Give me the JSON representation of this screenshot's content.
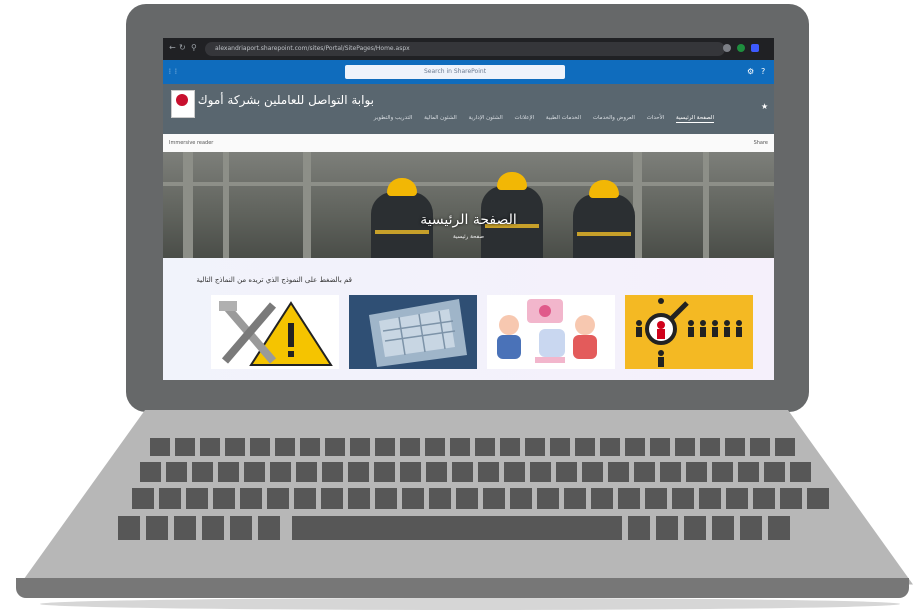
{
  "browser": {
    "url": "alexandriaport.sharepoint.com/sites/Portal/SitePages/Home.aspx"
  },
  "suite_bar": {
    "search_placeholder": "Search in SharePoint",
    "accent": "#0f6cbd"
  },
  "site": {
    "title": "بوابة التواصل للعاملين بشركة أموك",
    "nav": [
      {
        "label": "الصفحة الرئيسية",
        "active": true
      },
      {
        "label": "الأحداث",
        "active": false
      },
      {
        "label": "العروض والخدمات",
        "active": false
      },
      {
        "label": "الخدمات الطبية",
        "active": false
      },
      {
        "label": "الإعلانات",
        "active": false
      },
      {
        "label": "الشئون الإدارية",
        "active": false
      },
      {
        "label": "الشئون المالية",
        "active": false
      },
      {
        "label": "التدريب والتطوير",
        "active": false
      }
    ]
  },
  "command_bar": {
    "left": "Immersive reader",
    "right": "Share"
  },
  "hero": {
    "title": "الصفحة الرئيسية",
    "subtitle": "صفحة رئيسية"
  },
  "content": {
    "prompt": "قم بالضغط على النموذج الذي تريده من النماذج التالية"
  },
  "cards": [
    {
      "icon": "tools-warning-icon"
    },
    {
      "icon": "keyboard-icon"
    },
    {
      "icon": "people-chat-icon"
    },
    {
      "icon": "magnifier-people-icon"
    }
  ]
}
